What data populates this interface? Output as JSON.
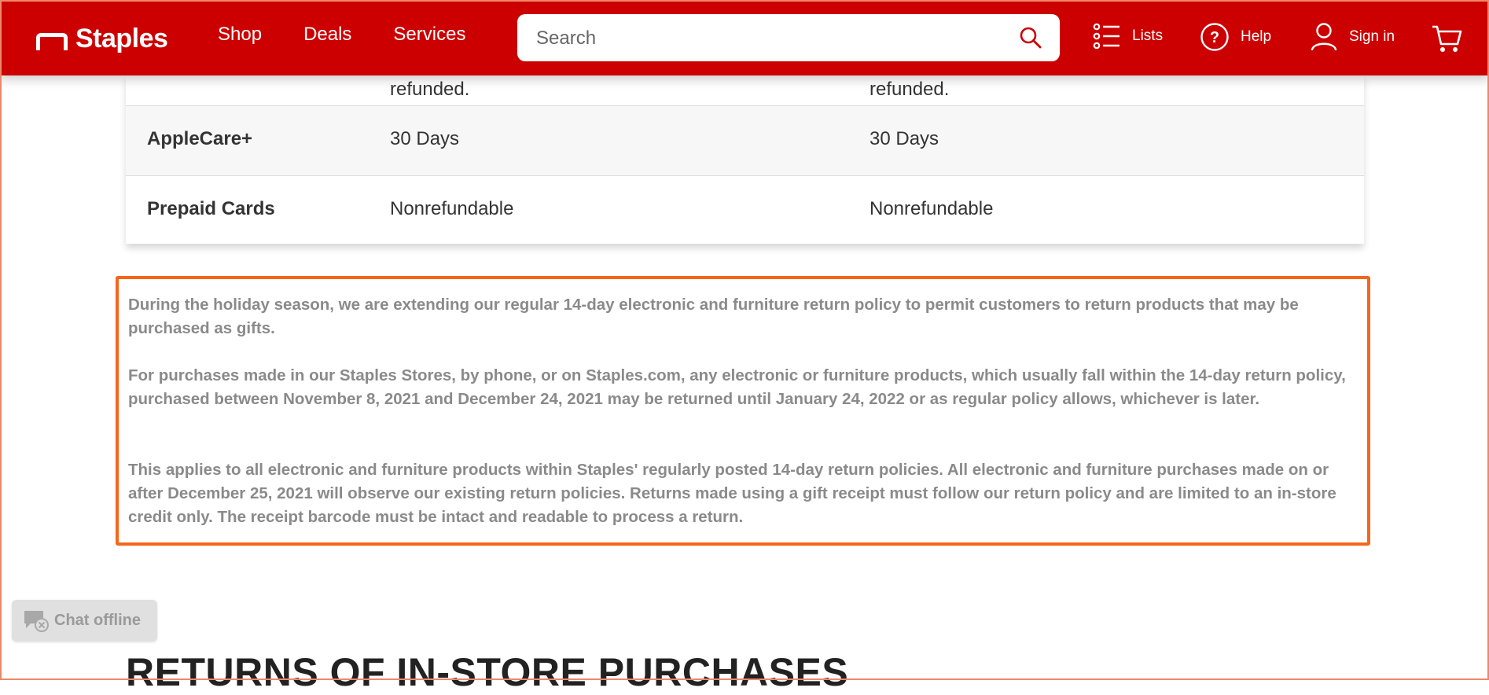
{
  "header": {
    "logo_text": "Staples",
    "nav": [
      "Shop",
      "Deals",
      "Services"
    ],
    "search_placeholder": "Search",
    "lists_label": "Lists",
    "help_label": "Help",
    "signin_label": "Sign in",
    "accent_color": "#cc0000"
  },
  "table": {
    "cut_text_1": "refunded.",
    "cut_text_2": "refunded.",
    "rows": [
      {
        "name": "AppleCare+",
        "col1": "30 Days",
        "col2": "30 Days"
      },
      {
        "name": "Prepaid Cards",
        "col1": "Nonrefundable",
        "col2": "Nonrefundable"
      }
    ]
  },
  "notice": {
    "border_color": "#f4661b",
    "p1": "During the holiday season, we are extending our regular 14-day electronic and furniture return policy to permit customers to return products that may be purchased as gifts.",
    "p2": "For purchases made in our Staples Stores, by phone, or on Staples.com, any electronic or furniture products, which usually fall within the 14-day return policy, purchased between November 8, 2021 and December 24, 2021 may be returned until January 24, 2022 or as regular policy allows, whichever is later.",
    "p3": "This applies to all electronic and furniture products within Staples' regularly posted 14-day return policies. All electronic and furniture purchases made on or after December 25, 2021 will observe our existing return policies. Returns made using a gift receipt must follow our return policy and are limited to an in-store credit only. The receipt barcode must be intact and readable to process a return."
  },
  "chat": {
    "label": "Chat offline"
  },
  "section": {
    "title": "RETURNS OF IN-STORE PURCHASES"
  }
}
